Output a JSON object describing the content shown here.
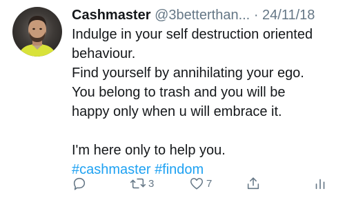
{
  "tweet": {
    "author": {
      "display_name": "Cashmaster",
      "handle": "@3betterthan...",
      "avatar_icon": "profile-photo-avatar"
    },
    "separator": "·",
    "date": "24/11/18",
    "lines": [
      "Indulge in your self destruction oriented",
      "behaviour.",
      "Find yourself by annihilating your ego.",
      "You belong to trash and you will be",
      "happy only when u will embrace it.",
      "I'm here only to help you."
    ],
    "hashtags": [
      "#cashmaster",
      "#findom"
    ],
    "actions": {
      "reply_icon": "reply-icon",
      "retweet_icon": "retweet-icon",
      "retweet_count": "3",
      "like_icon": "heart-icon",
      "like_count": "7",
      "share_icon": "share-icon",
      "analytics_icon": "analytics-icon"
    }
  },
  "colors": {
    "text": "#14171a",
    "secondary": "#657786",
    "link": "#1da1f2",
    "background": "#ffffff"
  }
}
